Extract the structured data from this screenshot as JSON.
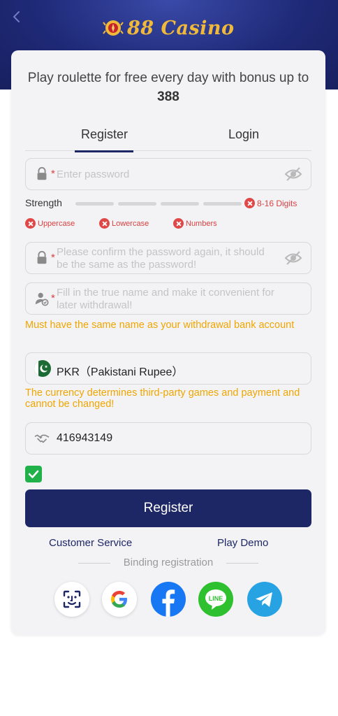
{
  "header": {
    "logo_text": "88 Casino",
    "back_icon": "chevron-left-icon"
  },
  "promo": {
    "text": "Play roulette for free every day with bonus up to",
    "amount": "388"
  },
  "tabs": [
    {
      "label": "Register",
      "active": true
    },
    {
      "label": "Login",
      "active": false
    }
  ],
  "password": {
    "required_mark": "*",
    "placeholder": "Enter password"
  },
  "strength": {
    "label": "Strength",
    "length_rule": "8-16 Digits",
    "rules": [
      "Uppercase",
      "Lowercase",
      "Numbers"
    ]
  },
  "confirm_password": {
    "required_mark": "*",
    "placeholder": "Please confirm the password again, it should be the same as the password!"
  },
  "real_name": {
    "required_mark": "*",
    "placeholder": "Fill in the true name and make it convenient for later withdrawal!",
    "hint": "Must have the same name as your withdrawal bank account"
  },
  "currency": {
    "value": "PKR（Pakistani Rupee）",
    "hint": "The currency determines third-party games and payment and cannot be changed!"
  },
  "referral": {
    "value": "416943149"
  },
  "agree_checked": true,
  "actions": {
    "register": "Register",
    "customer_service": "Customer Service",
    "play_demo": "Play Demo",
    "binding": "Binding registration"
  },
  "social": [
    "face-id-icon",
    "google-icon",
    "facebook-icon",
    "line-icon",
    "telegram-icon"
  ],
  "colors": {
    "primary": "#1e2766",
    "warning": "#f0a500",
    "error": "#e04848",
    "success": "#21b14b"
  }
}
